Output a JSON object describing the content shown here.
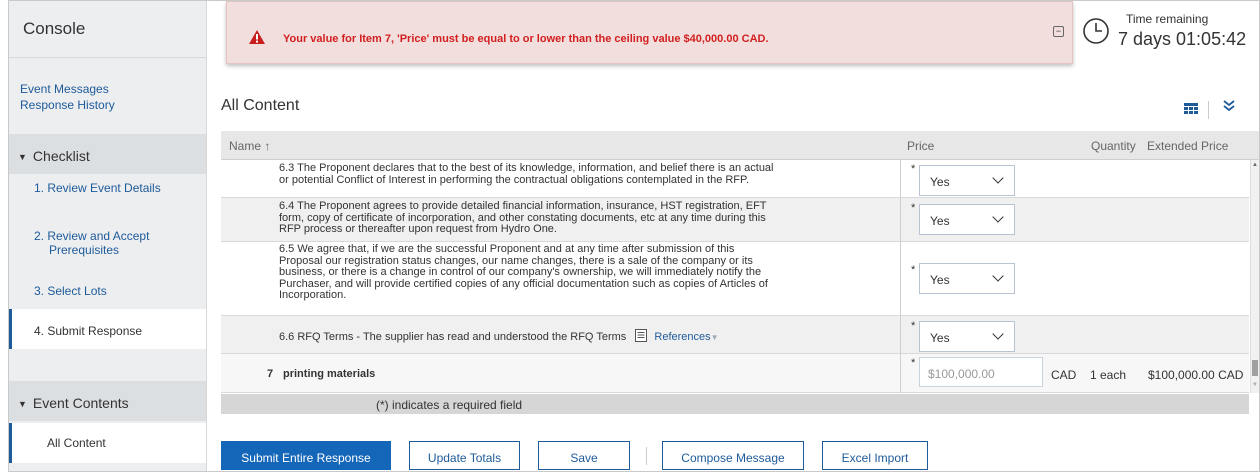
{
  "sidebar": {
    "title": "Console",
    "links": [
      "Event Messages",
      "Response History"
    ],
    "checklist_title": "Checklist",
    "checklist": [
      "1.  Review Event Details",
      "2.  Review and Accept",
      "Prerequisites",
      "3.  Select Lots",
      "4.  Submit Response"
    ],
    "event_contents_title": "Event Contents",
    "event_contents_item": "All Content"
  },
  "alert": {
    "message": "Your value for Item 7, 'Price' must be equal to or lower than the ceiling value $40,000.00 CAD.",
    "collapse_glyph": "−"
  },
  "timer": {
    "label": "Time remaining",
    "value": "7 days 01:05:42"
  },
  "content": {
    "title": "All Content",
    "headers": {
      "name": "Name ↑",
      "price": "Price",
      "quantity": "Quantity",
      "extended": "Extended Price"
    },
    "rows": [
      {
        "lines": [
          "6.3  The Proponent declares that to the best of its knowledge, information, and belief there is an actual",
          "or potential Conflict of Interest in performing the contractual obligations contemplated in the RFP."
        ],
        "value": "Yes"
      },
      {
        "lines": [
          "6.4  The Proponent agrees to provide detailed financial information, insurance, HST registration,  EFT",
          "form, copy of certificate of incorporation, and other constating documents, etc at any time during this",
          "RFP process or thereafter upon request from Hydro One."
        ],
        "value": "Yes"
      },
      {
        "lines": [
          "6.5  We agree that, if we are the successful Proponent and at any time after submission of this",
          "Proposal our registration status changes, our name changes, there is a sale of the company or its",
          "business, or there is a change in control of our company's ownership, we will immediately notify the",
          "Purchaser, and will provide certified copies of any official documentation such as copies of Articles of",
          "Incorporation."
        ],
        "value": "Yes"
      },
      {
        "text": "6.6  RFQ Terms - The supplier has read and understood the RFQ Terms",
        "refs": "References",
        "value": "Yes"
      }
    ],
    "item7": {
      "number": "7",
      "name": "printing materials",
      "price": "$100,000.00",
      "currency": "CAD",
      "quantity": "1 each",
      "extended": "$100,000.00 CAD"
    },
    "required_asterisk": "*",
    "footer_note": "(*) indicates a required field"
  },
  "buttons": {
    "submit": "Submit Entire Response",
    "update": "Update Totals",
    "save": "Save",
    "compose": "Compose Message",
    "excel": "Excel Import"
  },
  "colors": {
    "accent": "#1466b8",
    "link": "#1f5a99",
    "error": "#d21f1f",
    "alert_bg": "#f3dede"
  }
}
